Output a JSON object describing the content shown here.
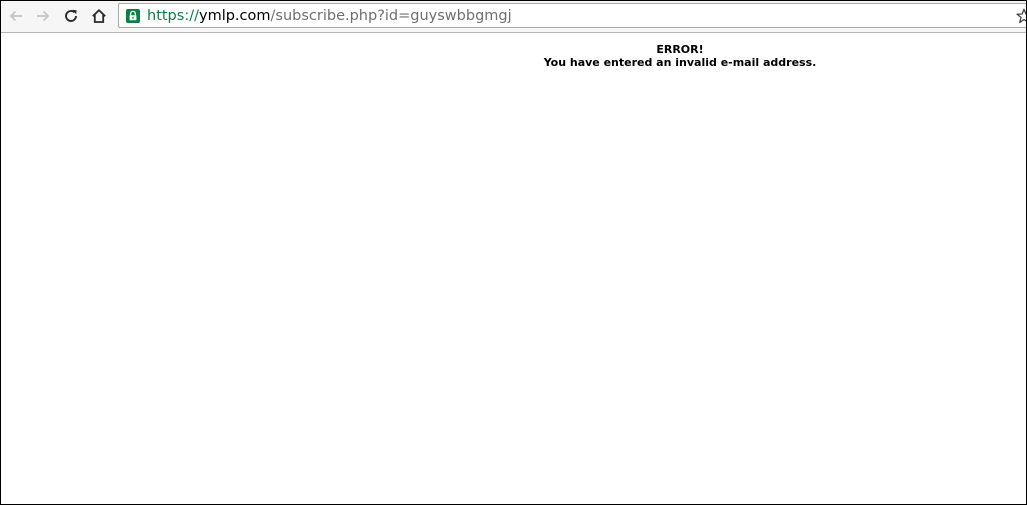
{
  "browser": {
    "url_scheme": "https://",
    "url_host": "ymlp.com",
    "url_path": "/subscribe.php?id=guyswbbgmgj",
    "icons": {
      "back": "back-arrow-icon",
      "forward": "forward-arrow-icon",
      "reload": "reload-icon",
      "home": "home-icon",
      "secure": "lock-icon",
      "bookmark": "star-icon"
    },
    "colors": {
      "secure_green": "#0b8043",
      "path_gray": "#6f6f6f"
    }
  },
  "page": {
    "error_title": "ERROR!",
    "error_message": "You have entered an invalid e-mail address."
  }
}
